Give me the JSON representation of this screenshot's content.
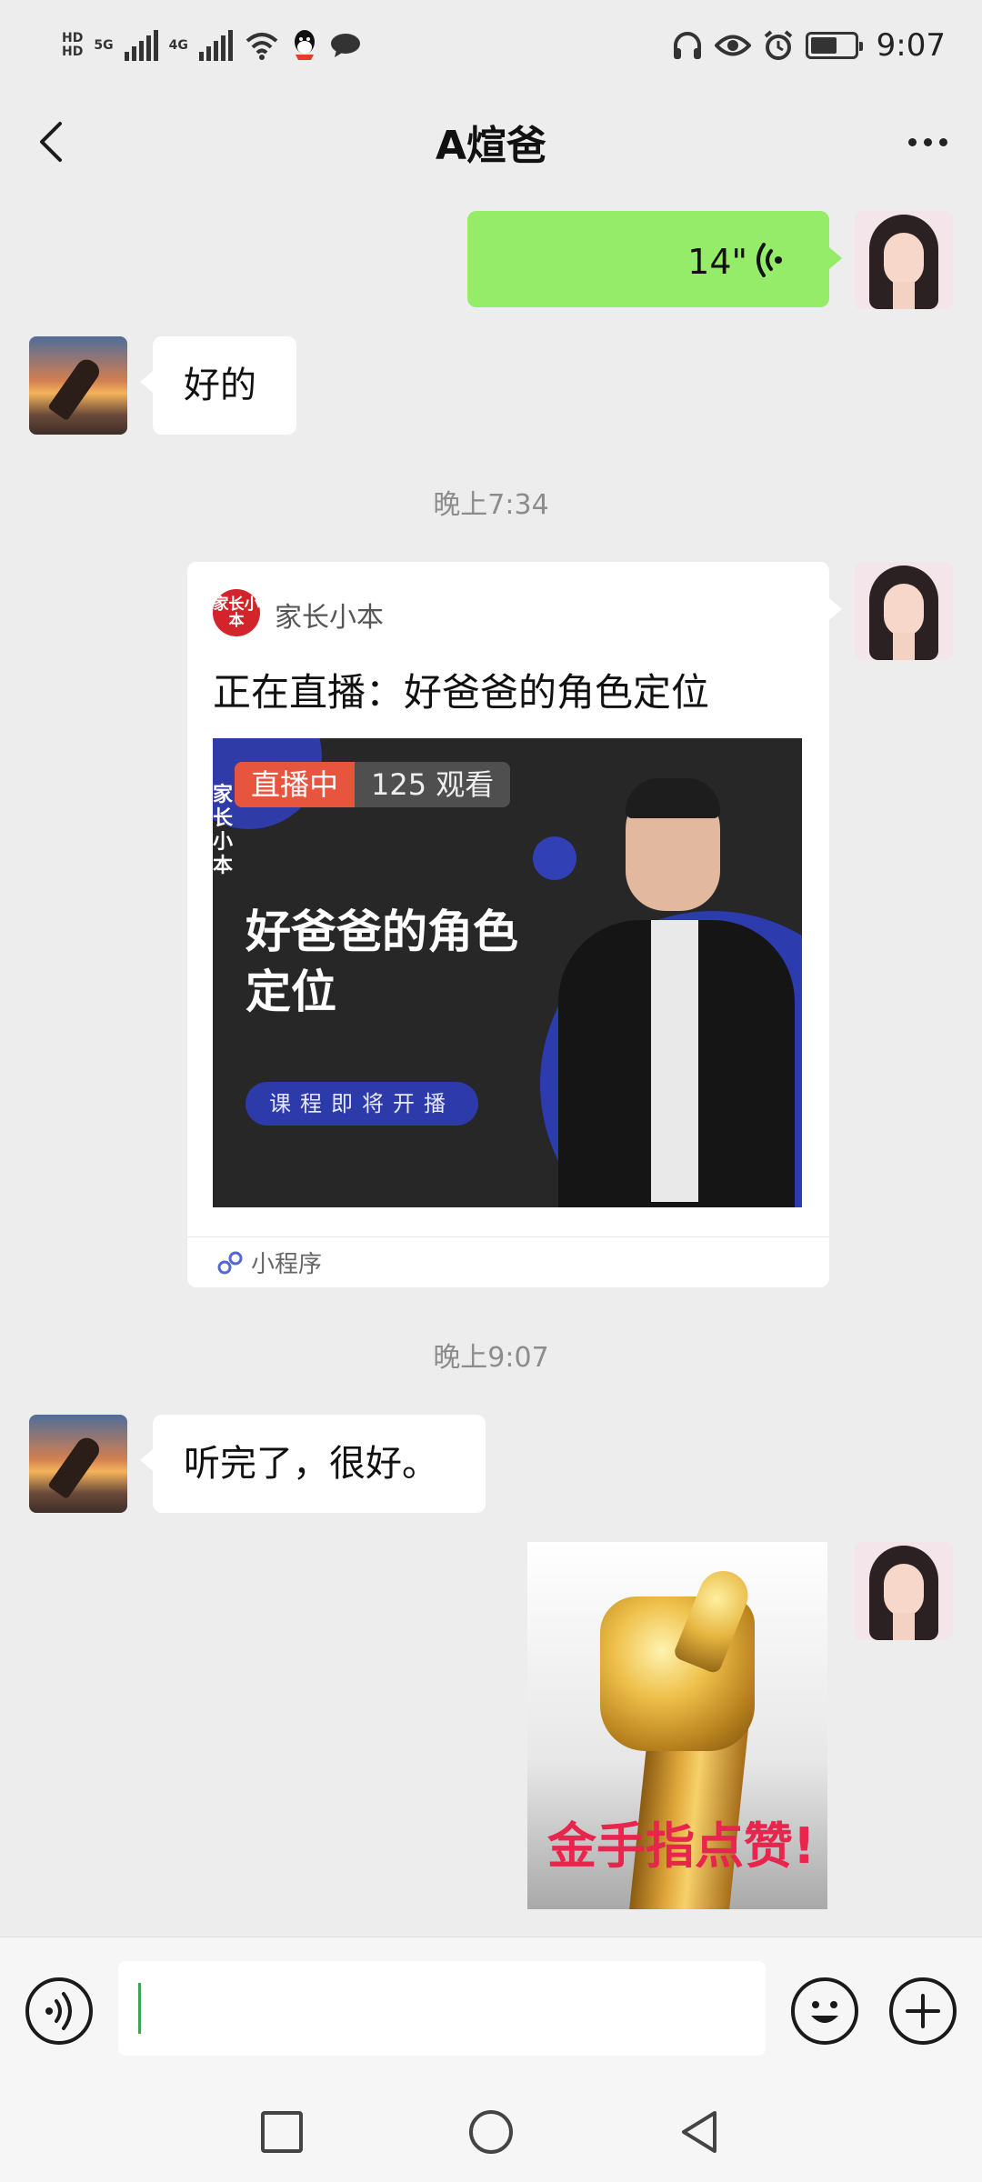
{
  "status_bar": {
    "hd_1": "HD",
    "hd_2": "HD",
    "net_5g": "5G",
    "net_4g": "4G",
    "time": "9:07",
    "icons": [
      "qq-icon",
      "chat-notification-icon",
      "headphones-icon",
      "eye-icon",
      "alarm-icon",
      "battery-icon"
    ]
  },
  "header": {
    "title": "A煊爸"
  },
  "messages": {
    "voice": {
      "duration": "14\"",
      "sender": "me"
    },
    "reply_1": {
      "text": "好的",
      "sender": "contact"
    },
    "time_1": "晚上7:34",
    "mini_program": {
      "source": "家长小本",
      "logo_text": "家长小本",
      "title": "正在直播：好爸爸的角色定位",
      "live_badge": "直播中",
      "views": "125 观看",
      "brand_corner": "家长小本",
      "headline": "好爸爸的角色定位",
      "pill": "课程即将开播",
      "footer": "小程序",
      "sender": "me"
    },
    "time_2": "晚上9:07",
    "reply_2": {
      "text": "听完了，很好。",
      "sender": "contact"
    },
    "sticker": {
      "caption": "金手指点赞!",
      "sender": "me"
    }
  },
  "input_bar": {
    "value": "",
    "placeholder": ""
  },
  "colors": {
    "background": "#ededed",
    "sent_bubble": "#95ec69",
    "received_bubble": "#ffffff",
    "live_badge": "#e8553f",
    "caret": "#3fa44b",
    "sticker_text": "#e8254d"
  }
}
